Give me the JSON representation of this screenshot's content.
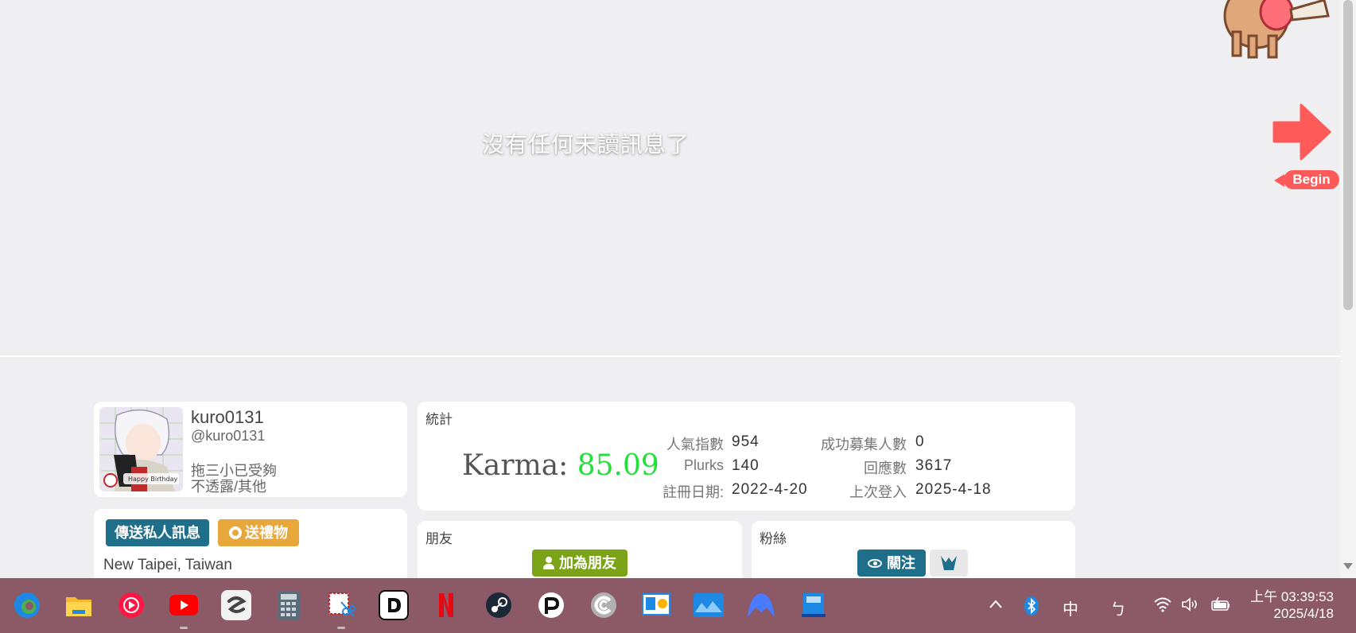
{
  "timeline": {
    "empty_message": "沒有任何未讀訊息了",
    "begin_label": "Begin"
  },
  "profile": {
    "display_name": "kuro0131",
    "handle": "@kuro0131",
    "bio": "拖三小已受夠",
    "gender_info": "不透露/其他",
    "avatar_caption": "Happy Birthday"
  },
  "actions": {
    "send_message_label": "傳送私人訊息",
    "gift_label": "送禮物",
    "location": "New Taipei, Taiwan"
  },
  "stats": {
    "title": "統計",
    "karma_label": "Karma: ",
    "karma_value": "85.09",
    "popularity_label": "人氣指數",
    "popularity_value": "954",
    "recruited_label": "成功募集人數",
    "recruited_value": "0",
    "plurks_label": "Plurks",
    "plurks_value": "140",
    "responses_label": "回應數",
    "responses_value": "3617",
    "registered_label": "註冊日期:",
    "registered_value": "2022-4-20",
    "last_login_label": "上次登入",
    "last_login_value": "2025-4-18"
  },
  "friends": {
    "title": "朋友",
    "add_friend_label": "加為朋友"
  },
  "fans": {
    "title": "粉絲",
    "follow_label": "關注"
  },
  "taskbar": {
    "apps": [
      "edge-icon",
      "file-explorer-icon",
      "youtube-music-icon",
      "youtube-icon",
      "clip-studio-icon",
      "calculator-icon",
      "snipping-tool-icon",
      "dlsite-icon",
      "netflix-icon",
      "steam-icon",
      "pixiv-icon",
      "ccleaner-icon",
      "presentation-icon",
      "photos-icon",
      "nordvpn-icon",
      "notebook-icon"
    ],
    "ime_label": "中",
    "ime_mode": "ㄅ",
    "time": "上午 03:39:53",
    "date": "2025/4/18"
  },
  "colors": {
    "accent_blue": "#1f6f8b",
    "gift_orange": "#e8a73a",
    "add_green": "#7aa318",
    "karma_green": "#22e03a",
    "begin_red": "#ff5a5a",
    "taskbar": "#8c5a66"
  }
}
